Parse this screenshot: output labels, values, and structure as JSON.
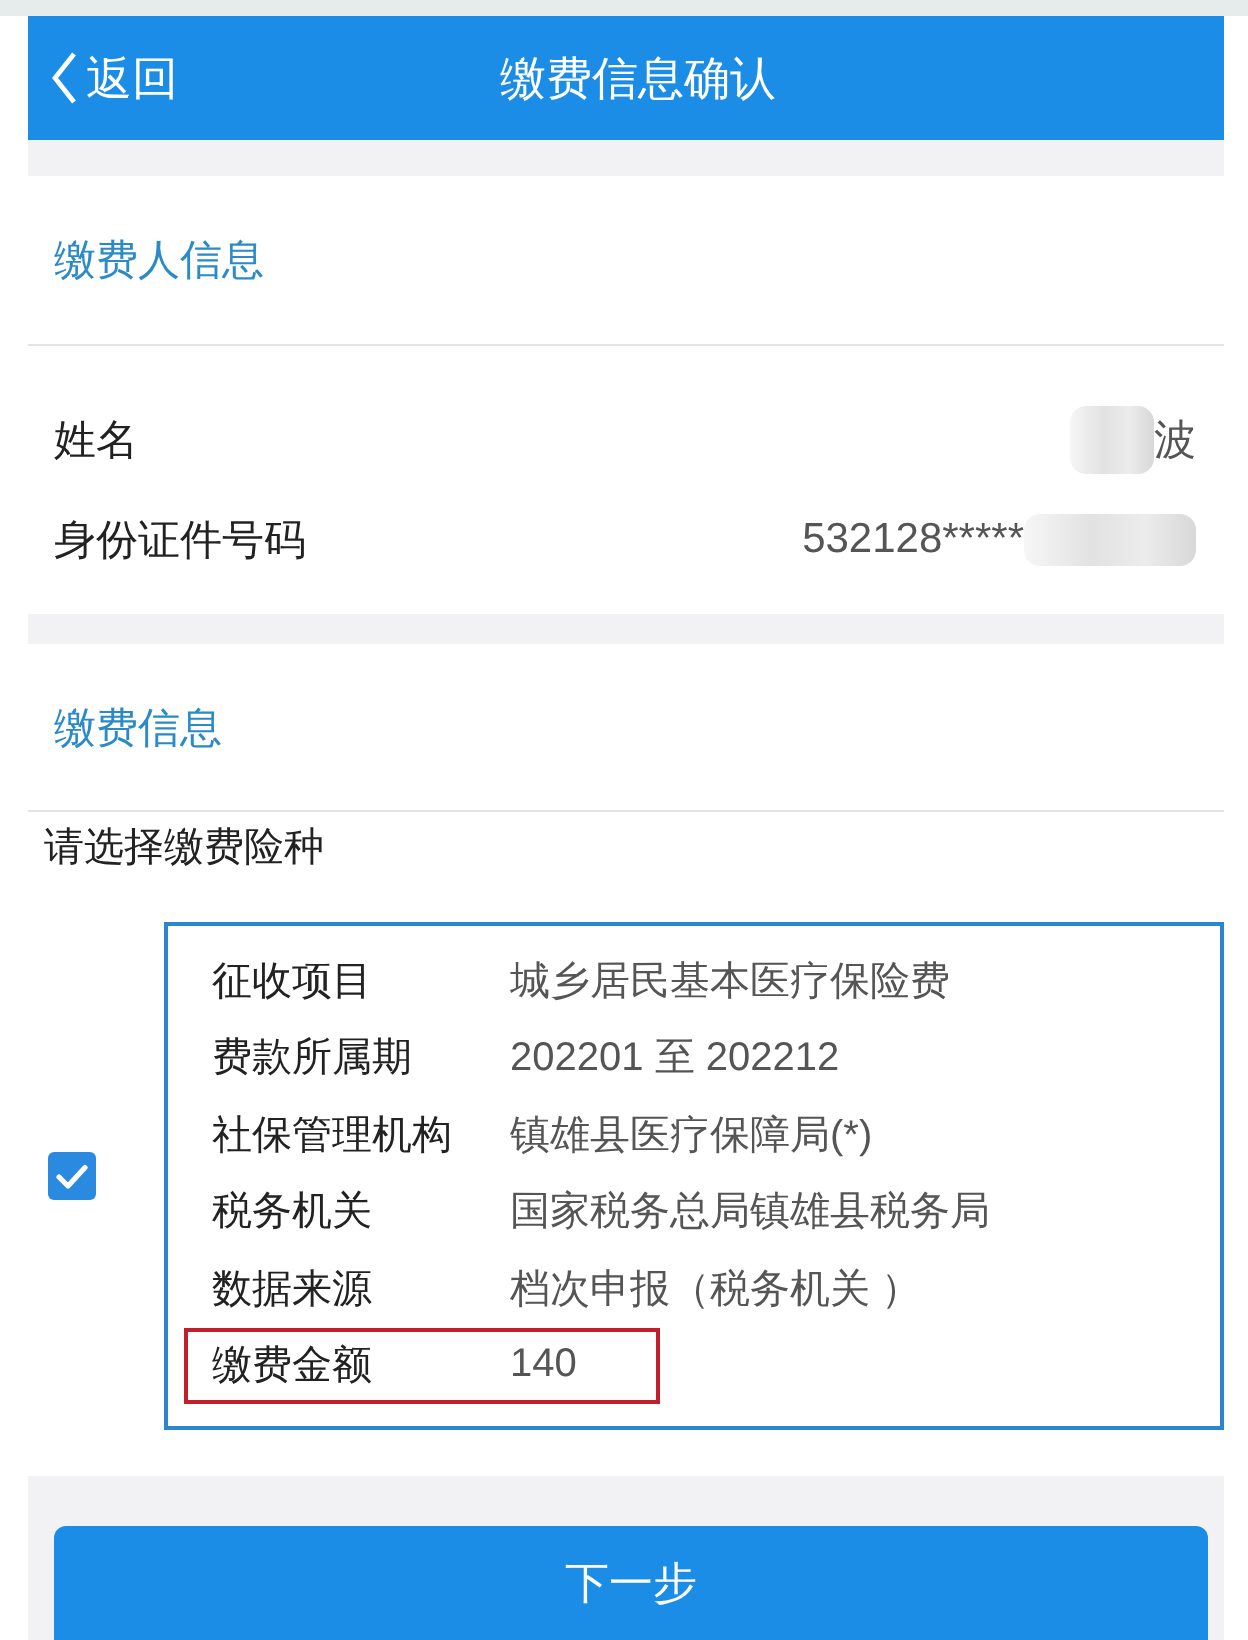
{
  "header": {
    "back_label": "返回",
    "title": "缴费信息确认"
  },
  "payer_section": {
    "title": "缴费人信息",
    "fields": [
      {
        "label": "姓名",
        "value": "波",
        "redacted_before": true,
        "redacted_after": false
      },
      {
        "label": "身份证件号码",
        "value": "532128*****",
        "redacted_before": false,
        "redacted_after": true
      }
    ]
  },
  "payment_section": {
    "title": "缴费信息",
    "prompt": "请选择缴费险种",
    "items": [
      {
        "checked": true,
        "rows": [
          {
            "label": "征收项目",
            "value": "城乡居民基本医疗保险费",
            "highlighted": false
          },
          {
            "label": "费款所属期",
            "value": "202201 至 202212",
            "highlighted": false
          },
          {
            "label": "社保管理机构",
            "value": "镇雄县医疗保障局(*)",
            "highlighted": false
          },
          {
            "label": "税务机关",
            "value": "国家税务总局镇雄县税务局",
            "highlighted": false
          },
          {
            "label": "数据来源",
            "value": "档次申报（税务机关 ）",
            "highlighted": false
          },
          {
            "label": "缴费金额",
            "value": "140",
            "highlighted": true
          }
        ]
      }
    ]
  },
  "next_button": {
    "label": "下一步"
  }
}
